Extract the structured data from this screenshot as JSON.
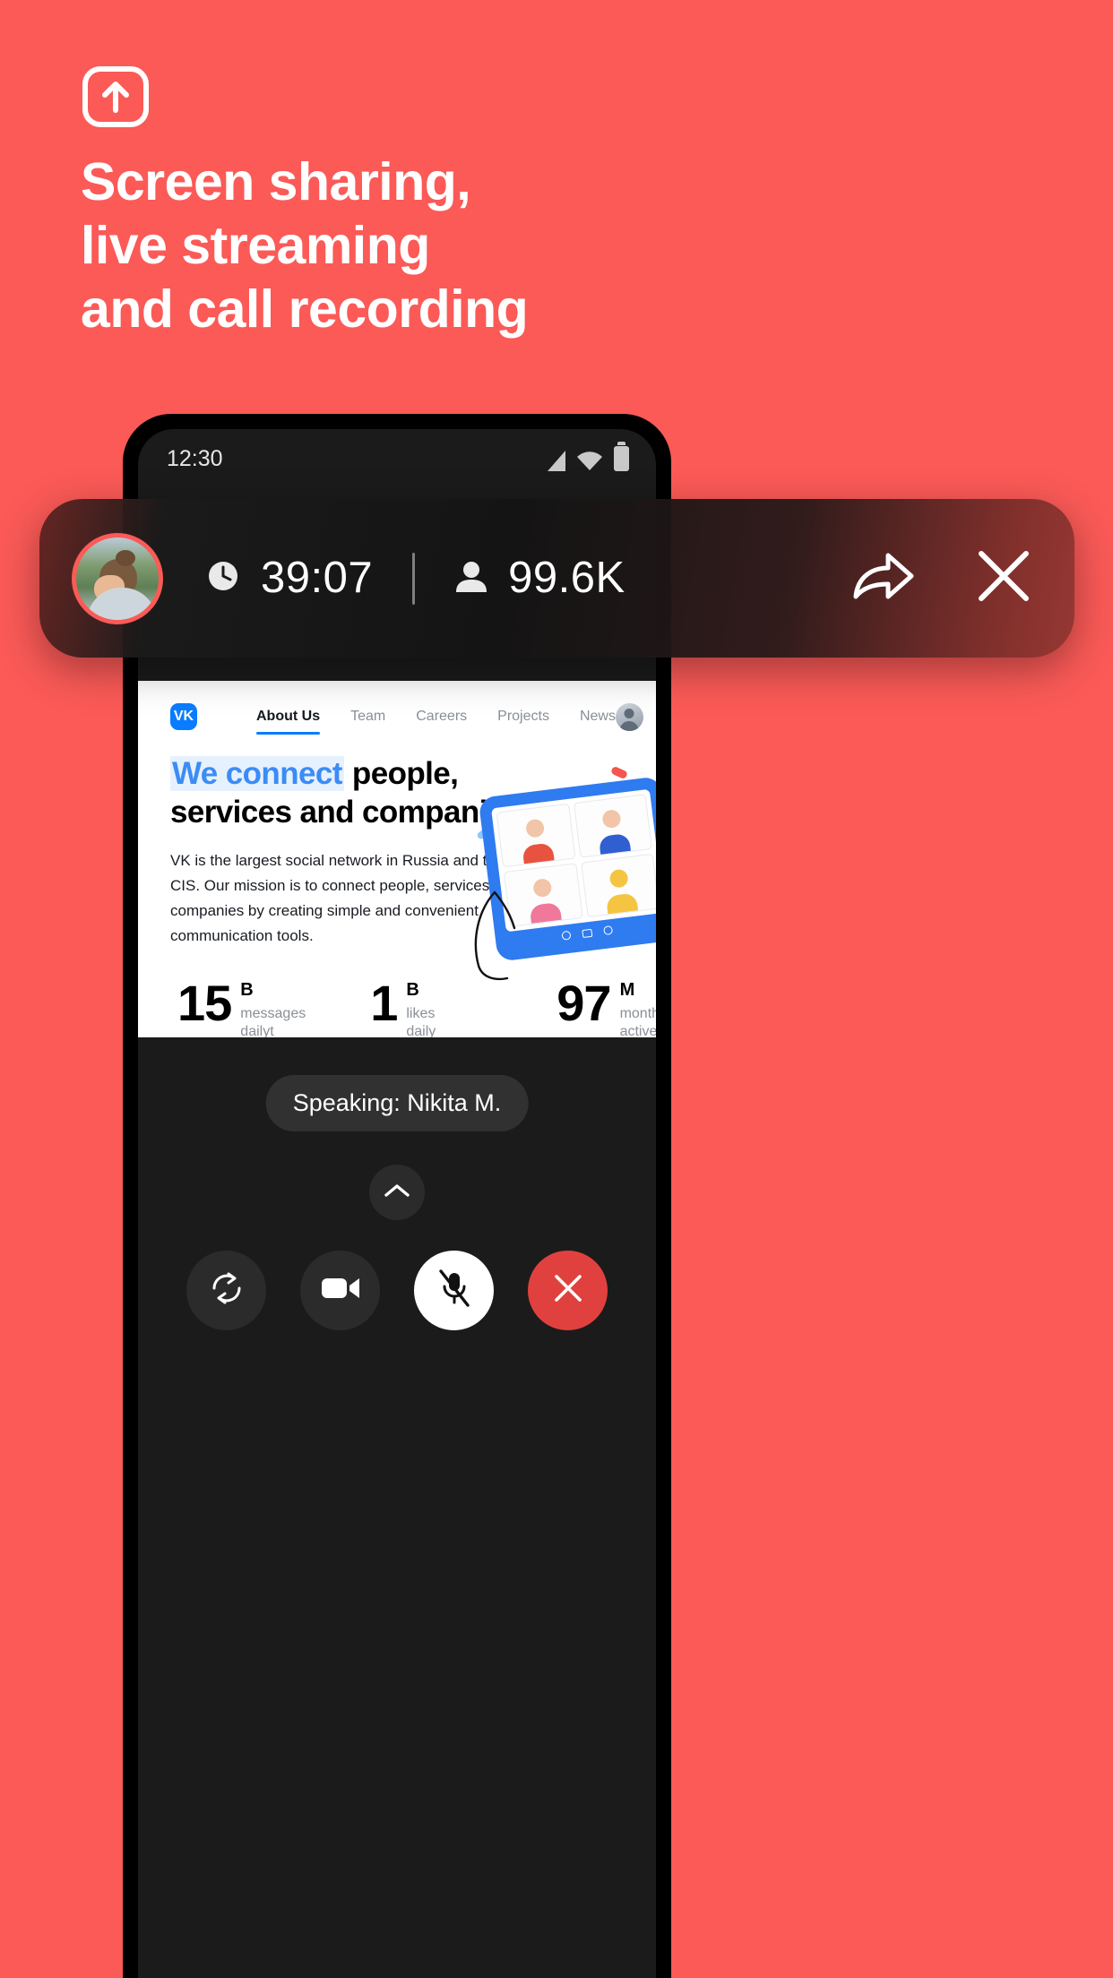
{
  "promo": {
    "icon": "screen-share-up-arrow-icon",
    "headline_lines": [
      "Screen sharing,",
      "live streaming",
      "and call recording"
    ],
    "background_color": "#FB5A57",
    "text_color": "#FFFFFF"
  },
  "phone": {
    "status_bar": {
      "time": "12:30",
      "icons": [
        "signal-icon",
        "wifi-icon",
        "battery-icon"
      ]
    }
  },
  "broadcast_overlay": {
    "avatar": "broadcaster-avatar",
    "timer_icon": "clock-icon",
    "timer": "39:07",
    "viewers_icon": "person-icon",
    "viewers": "99.6K",
    "share_icon": "share-arrow-icon",
    "close_icon": "close-x-icon",
    "ring_color": "#FB5A57"
  },
  "shared_screen": {
    "logo": "vk-logo",
    "logo_text": "VK",
    "nav": [
      {
        "label": "About Us",
        "active": true
      },
      {
        "label": "Team",
        "active": false
      },
      {
        "label": "Careers",
        "active": false
      },
      {
        "label": "Projects",
        "active": false
      },
      {
        "label": "News",
        "active": false
      }
    ],
    "account_avatar": "user-avatar",
    "heading": {
      "highlight": "We connect",
      "rest_line1": " people,",
      "line2": "services and companies"
    },
    "paragraph": "VK is the largest social network in Russia and the CIS. Our mission is to connect people, services and companies by creating simple and convenient communication tools.",
    "accent_color": "#3B8CF5",
    "stats": [
      {
        "value": "15",
        "unit": "B",
        "label": "messages\ndailyt"
      },
      {
        "value": "1",
        "unit": "B",
        "label": "likes daily"
      },
      {
        "value": "97",
        "unit": "M",
        "label": "monthly\nactive users"
      }
    ]
  },
  "call_controls": {
    "speaking_label": "Speaking: Nikita M.",
    "expand_icon": "chevron-up-icon",
    "buttons": [
      {
        "name": "switch-camera-button",
        "icon": "camera-flip-icon",
        "style": "dark"
      },
      {
        "name": "video-toggle-button",
        "icon": "video-camera-icon",
        "style": "dark"
      },
      {
        "name": "mute-button",
        "icon": "microphone-muted-icon",
        "style": "white"
      },
      {
        "name": "end-call-button",
        "icon": "close-x-icon",
        "style": "red"
      }
    ]
  }
}
